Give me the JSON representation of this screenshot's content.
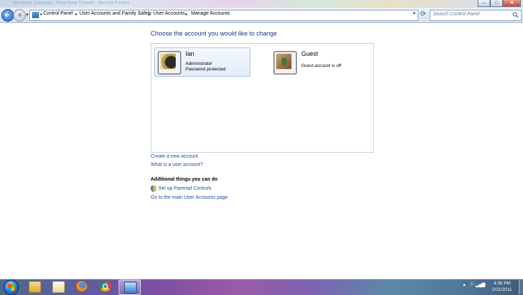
{
  "window": {
    "title_text": "Windows Cleanup - Post New Thread - Mozilla Firefox",
    "buttons": {
      "minimize": "–",
      "maximize": "□",
      "close": "✕"
    }
  },
  "address_bar": {
    "breadcrumbs": [
      "Control Panel",
      "User Accounts and Family Safety",
      "User Accounts",
      "Manage Accounts"
    ],
    "search_placeholder": "Search Control Panel"
  },
  "content": {
    "heading": "Choose the account you would like to change",
    "accounts": [
      {
        "name": "Ian",
        "line1": "Administrator",
        "line2": "Password protected",
        "picture": "sunflower-icon"
      },
      {
        "name": "Guest",
        "line1": "Guest account is off",
        "line2": "",
        "picture": "briefcase-icon"
      }
    ],
    "links": {
      "create_account": "Create a new account",
      "what_is": "What is a user account?"
    },
    "additional": {
      "heading": "Additional things you can do",
      "parental": "Set up Parental Controls",
      "main_page": "Go to the main User Accounts page"
    }
  },
  "taskbar": {
    "pinned": [
      "explorer-icon",
      "photos-icon",
      "firefox-icon",
      "chrome-icon",
      "control-panel-icon"
    ],
    "active_index": 4,
    "time": "4:38 PM",
    "date": "2/21/2011"
  },
  "colors": {
    "heading": "#1e3287",
    "link": "#1e4e9c"
  }
}
